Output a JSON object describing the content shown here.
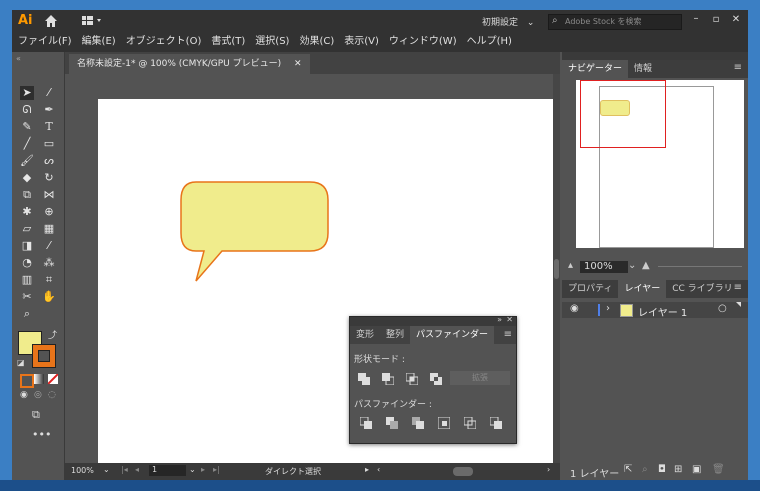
{
  "app": {
    "logo": "Ai",
    "workspace": "初期設定",
    "stock_search_placeholder": "Adobe Stock を検索"
  },
  "menu": [
    "ファイル(F)",
    "編集(E)",
    "オブジェクト(O)",
    "書式(T)",
    "選択(S)",
    "効果(C)",
    "表示(V)",
    "ウィンドウ(W)",
    "ヘルプ(H)"
  ],
  "document": {
    "tab_title": "名称未設定-1* @ 100% (CMYK/GPU プレビュー)"
  },
  "status": {
    "zoom": "100%",
    "artboard": "1",
    "tool": "ダイレクト選択"
  },
  "navigator": {
    "tabs": [
      "ナビゲーター",
      "情報"
    ],
    "zoom": "100%"
  },
  "layers": {
    "tabs": [
      "プロパティ",
      "レイヤー",
      "CC ライブラリ"
    ],
    "layer_name": "レイヤー 1",
    "count_label": "1 レイヤー"
  },
  "pathfinder": {
    "tabs": [
      "変形",
      "整列",
      "パスファインダー"
    ],
    "shape_modes_label": "形状モード :",
    "expand_label": "拡張",
    "pathfinders_label": "パスファインダー :"
  },
  "colors": {
    "fill": "#f0ec8c",
    "stroke": "#e8741a",
    "layer_color": "#4f7fe8"
  }
}
